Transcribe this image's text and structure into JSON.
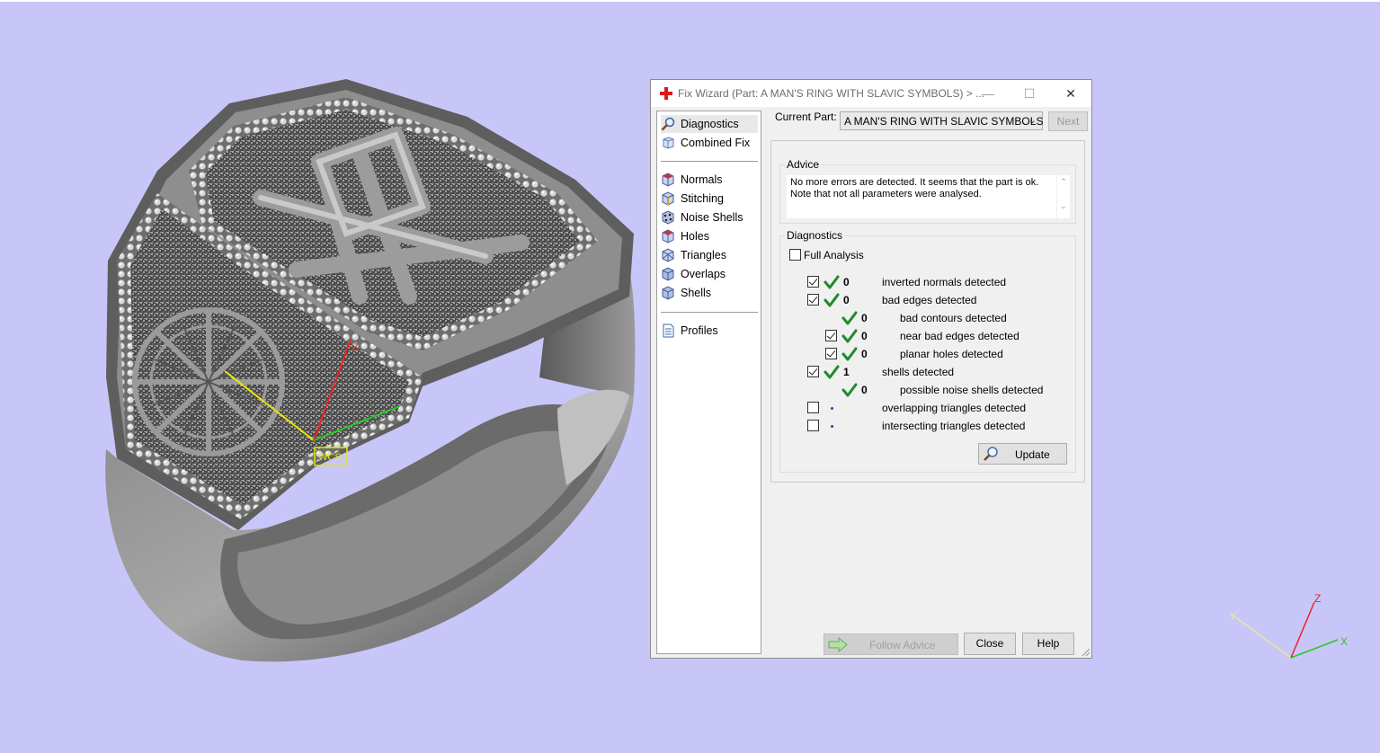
{
  "dialog": {
    "title": "Fix Wizard (Part: A MAN'S RING WITH SLAVIC SYMBOLS) > ...",
    "window_buttons": {
      "minimize": "—",
      "maximize": "☐",
      "close": "✕"
    },
    "nav": {
      "primary": [
        {
          "label": "Diagnostics",
          "icon": "magnifier-icon",
          "selected": true
        },
        {
          "label": "Combined Fix",
          "icon": "combined-fix-icon"
        }
      ],
      "tools": [
        {
          "label": "Normals",
          "icon": "normals-cube-icon"
        },
        {
          "label": "Stitching",
          "icon": "stitching-cube-icon"
        },
        {
          "label": "Noise Shells",
          "icon": "noise-shells-icon"
        },
        {
          "label": "Holes",
          "icon": "holes-cube-icon"
        },
        {
          "label": "Triangles",
          "icon": "triangles-cube-icon"
        },
        {
          "label": "Overlaps",
          "icon": "overlaps-cube-icon"
        },
        {
          "label": "Shells",
          "icon": "shells-cube-icon"
        }
      ],
      "extra": [
        {
          "label": "Profiles",
          "icon": "profiles-document-icon"
        }
      ]
    },
    "current_part_label": "Current Part:",
    "current_part_value": "A MAN'S RING WITH SLAVIC SYMBOLS",
    "next_button": "Next",
    "advice": {
      "title": "Advice",
      "text_line1": "No more errors are detected. It seems that the part is ok.",
      "text_line2": "Note that not all parameters were analysed."
    },
    "diagnostics": {
      "title": "Diagnostics",
      "full_analysis_label": "Full Analysis",
      "full_analysis_checked": false,
      "rows": [
        {
          "checked": true,
          "has_checkbox": true,
          "status": "ok",
          "count": "0",
          "label": "inverted normals detected",
          "indent": 0
        },
        {
          "checked": true,
          "has_checkbox": true,
          "status": "ok",
          "count": "0",
          "label": "bad edges detected",
          "indent": 0
        },
        {
          "checked": false,
          "has_checkbox": false,
          "status": "ok",
          "count": "0",
          "label": "bad contours detected",
          "indent": 1
        },
        {
          "checked": true,
          "has_checkbox": true,
          "status": "ok",
          "count": "0",
          "label": "near bad edges detected",
          "indent": 1
        },
        {
          "checked": true,
          "has_checkbox": true,
          "status": "ok",
          "count": "0",
          "label": "planar holes detected",
          "indent": 1
        },
        {
          "checked": true,
          "has_checkbox": true,
          "status": "ok",
          "count": "1",
          "label": "shells detected",
          "indent": 0
        },
        {
          "checked": false,
          "has_checkbox": false,
          "status": "ok",
          "count": "0",
          "label": "possible noise shells detected",
          "indent": 1
        },
        {
          "checked": false,
          "has_checkbox": true,
          "status": "pending",
          "count": "",
          "label": "overlapping triangles detected",
          "indent": 0
        },
        {
          "checked": false,
          "has_checkbox": true,
          "status": "pending",
          "count": "",
          "label": "intersecting triangles detected",
          "indent": 0
        }
      ],
      "update_button": "Update"
    },
    "footer": {
      "follow_advice": "Follow Advice",
      "close": "Close",
      "help": "Help"
    }
  },
  "viewport": {
    "wcs_label": "WCS",
    "local_axes": {
      "x": "",
      "y": "",
      "z": "Z"
    },
    "corner_axes": {
      "x": "X",
      "y": "Y",
      "z": "Z"
    }
  },
  "colors": {
    "viewport_background": "#c8c6f8",
    "ok_check": "#1f8a2a",
    "axis_x": "#22cc22",
    "axis_y": "#e8e800",
    "axis_z": "#ee2222"
  }
}
